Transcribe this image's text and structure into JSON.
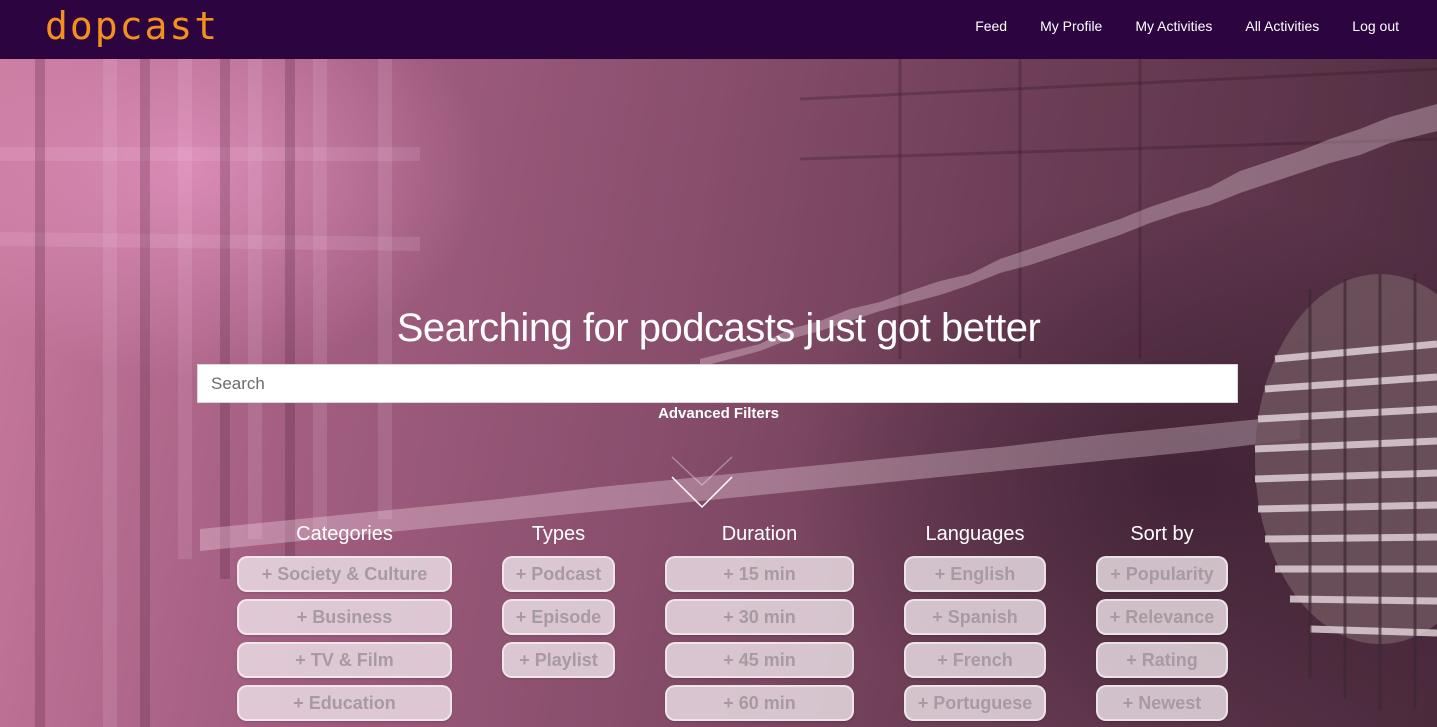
{
  "brand": {
    "logo": "dopcast",
    "color": "#f5901e"
  },
  "nav": {
    "items": [
      {
        "label": "Feed"
      },
      {
        "label": "My Profile"
      },
      {
        "label": "My Activities"
      },
      {
        "label": "All Activities"
      },
      {
        "label": "Log out"
      }
    ]
  },
  "hero": {
    "headline": "Searching for podcasts just got better",
    "search_placeholder": "Search",
    "advanced_filters_label": "Advanced Filters",
    "chevron_icon": "chevron-down-icon"
  },
  "filters": {
    "chip_prefix": "+",
    "categories": {
      "title": "Categories",
      "options": [
        "Society & Culture",
        "Business",
        "TV & Film",
        "Education"
      ]
    },
    "types": {
      "title": "Types",
      "options": [
        "Podcast",
        "Episode",
        "Playlist"
      ]
    },
    "duration": {
      "title": "Duration",
      "options": [
        "15 min",
        "30 min",
        "45 min",
        "60 min"
      ]
    },
    "languages": {
      "title": "Languages",
      "options": [
        "English",
        "Spanish",
        "French",
        "Portuguese"
      ]
    },
    "sort_by": {
      "title": "Sort by",
      "options": [
        "Popularity",
        "Relevance",
        "Rating",
        "Newest"
      ]
    }
  },
  "colors": {
    "navbar": "#2c0440",
    "accent": "#f5901e",
    "chip_text": "#a89aa2"
  }
}
